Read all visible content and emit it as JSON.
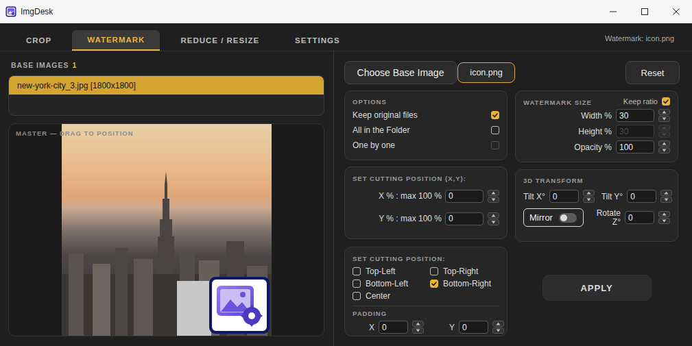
{
  "window": {
    "title": "ImgDesk"
  },
  "tabs": [
    {
      "label": "CROP",
      "selected": false
    },
    {
      "label": "WATERMARK",
      "selected": true
    },
    {
      "label": "REDUCE / RESIZE",
      "selected": false
    },
    {
      "label": "SETTINGS",
      "selected": false
    }
  ],
  "status": "Watermark: icon.png",
  "base_images": {
    "label": "BASE IMAGES",
    "count": "1",
    "items": [
      {
        "name": "new-york-city_3.jpg [1800x1800]",
        "selected": true
      }
    ]
  },
  "preview": {
    "label": "MASTER — DRAG TO POSITION"
  },
  "toolbar": {
    "choose": "Choose Base Image",
    "watermark_file": "icon.png",
    "reset": "Reset"
  },
  "options": {
    "title": "OPTIONS",
    "items": [
      {
        "label": "Keep original files",
        "checked": true,
        "disabled": false
      },
      {
        "label": "All in the Folder",
        "checked": false,
        "disabled": false
      },
      {
        "label": "One by one",
        "checked": false,
        "disabled": true
      }
    ]
  },
  "watermark_size": {
    "title": "WATERMARK SIZE",
    "keep_ratio": {
      "label": "Keep ratio",
      "checked": true
    },
    "fields": [
      {
        "label": "Width %",
        "value": "30",
        "disabled": false
      },
      {
        "label": "Height %",
        "value": "30",
        "disabled": true
      },
      {
        "label": "Opacity %",
        "value": "100",
        "disabled": false
      }
    ]
  },
  "cutting_xy": {
    "title": "SET CUTTING POSITION (X,Y):",
    "fields": [
      {
        "label": "X % : max 100 %",
        "value": "0"
      },
      {
        "label": "Y % : max 100 %",
        "value": "0"
      }
    ]
  },
  "transform": {
    "title": "3D TRANSFORM",
    "tilt_x": {
      "label": "Tilt X°",
      "value": "0"
    },
    "tilt_y": {
      "label": "Tilt Y°",
      "value": "0"
    },
    "mirror": {
      "label": "Mirror",
      "on": false
    },
    "rotate_z": {
      "label": "Rotate Z°",
      "value": "0"
    }
  },
  "cutting_position": {
    "title": "SET CUTTING POSITION:",
    "options": [
      {
        "label": "Top-Left",
        "selected": false
      },
      {
        "label": "Top-Right",
        "selected": false
      },
      {
        "label": "Bottom-Left",
        "selected": false
      },
      {
        "label": "Bottom-Right",
        "selected": true
      },
      {
        "label": "Center",
        "selected": false
      }
    ],
    "padding": {
      "title": "PADDING",
      "x": {
        "label": "X",
        "value": "0"
      },
      "y": {
        "label": "Y",
        "value": "0"
      }
    }
  },
  "apply": "APPLY"
}
